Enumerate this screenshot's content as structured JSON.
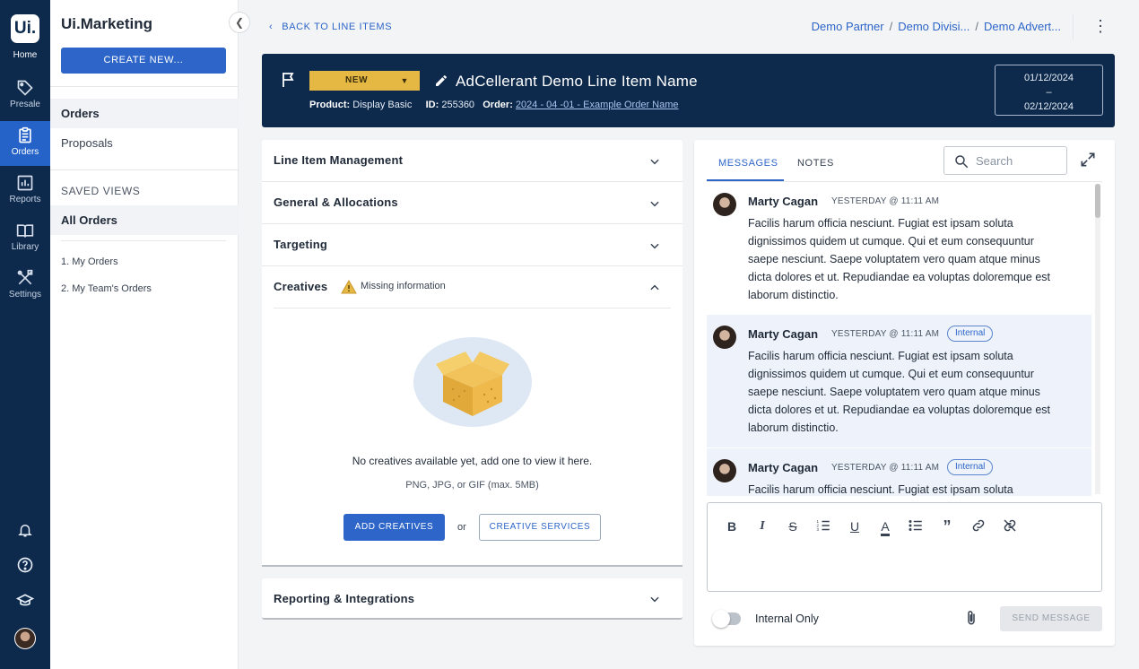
{
  "rail": {
    "logo": "Ui.",
    "home_label": "Home",
    "items": [
      {
        "label": "Presale",
        "icon": "tag-icon"
      },
      {
        "label": "Orders",
        "icon": "clipboard-icon"
      },
      {
        "label": "Reports",
        "icon": "chart-icon"
      },
      {
        "label": "Library",
        "icon": "book-icon"
      },
      {
        "label": "Settings",
        "icon": "tools-icon"
      }
    ],
    "active": "Orders",
    "colors": {
      "bg": "#0d2a4d",
      "active": "#2563c9"
    }
  },
  "nav": {
    "title": "Ui.Marketing",
    "create_label": "CREATE NEW...",
    "items": [
      {
        "label": "Orders"
      },
      {
        "label": "Proposals"
      }
    ],
    "saved_views_heading": "SAVED VIEWS",
    "saved_views": [
      {
        "label": "All Orders"
      },
      {
        "label": "1. My Orders"
      },
      {
        "label": "2. My Team's Orders"
      }
    ]
  },
  "topbar": {
    "back_label": "BACK TO LINE ITEMS",
    "breadcrumb": [
      "Demo Partner",
      "Demo Divisi...",
      "Demo Advert..."
    ]
  },
  "header": {
    "status": "NEW",
    "name": "AdCellerant Demo Line Item Name",
    "product_label": "Product:",
    "product_value": "Display Basic",
    "id_label": "ID:",
    "id_value": "255360",
    "order_label": "Order:",
    "order_value": "2024 - 04 -01 - Example Order Name",
    "date_start": "01/12/2024",
    "date_sep": "–",
    "date_end": "02/12/2024",
    "colors": {
      "bg": "#0d2a4d",
      "status": "#e5b843"
    }
  },
  "sections": {
    "line_item_management": "Line Item Management",
    "general_allocations": "General & Allocations",
    "targeting": "Targeting",
    "creatives": "Creatives",
    "creatives_warning": "Missing information",
    "empty_text": "No creatives available yet, add one to view it here.",
    "empty_sub": "PNG, JPG, or GIF (max. 5MB)",
    "add_label": "ADD CREATIVES",
    "or_label": "or",
    "services_label": "CREATIVE SERVICES",
    "reporting": "Reporting & Integrations"
  },
  "messages": {
    "tabs": [
      "MESSAGES",
      "NOTES"
    ],
    "search_placeholder": "Search",
    "items": [
      {
        "author": "Marty Cagan",
        "time": "YESTERDAY @ 11:11 AM",
        "tag": "",
        "body": "Facilis harum officia nesciunt. Fugiat est ipsam soluta dignissimos quidem ut cumque. Qui et eum consequuntur saepe nesciunt. Saepe voluptatem vero quam atque minus dicta dolores et ut. Repudiandae ea voluptas doloremque est laborum distinctio."
      },
      {
        "author": "Marty Cagan",
        "time": "YESTERDAY @ 11:11 AM",
        "tag": "Internal",
        "body": "Facilis harum officia nesciunt. Fugiat est ipsam soluta dignissimos quidem ut cumque. Qui et eum consequuntur saepe nesciunt. Saepe voluptatem vero quam atque minus dicta dolores et ut. Repudiandae ea voluptas doloremque est laborum distinctio."
      },
      {
        "author": "Marty Cagan",
        "time": "YESTERDAY @ 11:11 AM",
        "tag": "Internal",
        "body": "Facilis harum officia nesciunt. Fugiat est ipsam soluta"
      }
    ],
    "toolbar": [
      "bold-icon",
      "italic-icon",
      "strikethrough-icon",
      "numbered-list-icon",
      "underline-icon",
      "text-color-icon",
      "bullet-list-icon",
      "quote-icon",
      "link-icon",
      "unlink-icon"
    ],
    "internal_only_label": "Internal Only",
    "internal_only_on": false,
    "send_label": "SEND MESSAGE",
    "colors": {
      "accent": "#2d65c8",
      "internal_bg": "#eef3fb"
    }
  }
}
